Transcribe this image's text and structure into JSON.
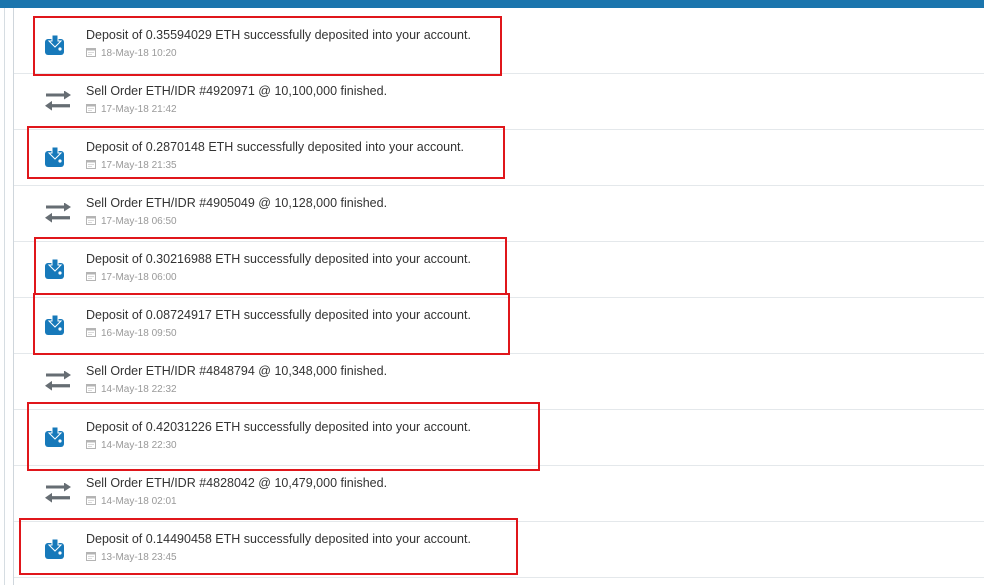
{
  "activity": {
    "items": [
      {
        "type": "deposit",
        "message": "Deposit of 0.35594029 ETH successfully deposited into your account.",
        "time": "18-May-18 10:20",
        "highlighted": true
      },
      {
        "type": "sell",
        "message": "Sell Order ETH/IDR #4920971 @ 10,100,000 finished.",
        "time": "17-May-18 21:42",
        "highlighted": false
      },
      {
        "type": "deposit",
        "message": "Deposit of 0.2870148 ETH successfully deposited into your account.",
        "time": "17-May-18 21:35",
        "highlighted": true
      },
      {
        "type": "sell",
        "message": "Sell Order ETH/IDR #4905049 @ 10,128,000 finished.",
        "time": "17-May-18 06:50",
        "highlighted": false
      },
      {
        "type": "deposit",
        "message": "Deposit of 0.30216988 ETH successfully deposited into your account.",
        "time": "17-May-18 06:00",
        "highlighted": true
      },
      {
        "type": "deposit",
        "message": "Deposit of 0.08724917 ETH successfully deposited into your account.",
        "time": "16-May-18 09:50",
        "highlighted": true
      },
      {
        "type": "sell",
        "message": "Sell Order ETH/IDR #4848794 @ 10,348,000 finished.",
        "time": "14-May-18 22:32",
        "highlighted": false
      },
      {
        "type": "deposit",
        "message": "Deposit of 0.42031226 ETH successfully deposited into your account.",
        "time": "14-May-18 22:30",
        "highlighted": true
      },
      {
        "type": "sell",
        "message": "Sell Order ETH/IDR #4828042 @ 10,479,000 finished.",
        "time": "14-May-18 02:01",
        "highlighted": false
      },
      {
        "type": "deposit",
        "message": "Deposit of 0.14490458 ETH successfully deposited into your account.",
        "time": "13-May-18 23:45",
        "highlighted": true
      }
    ]
  },
  "icons": {
    "deposit": "wallet-download-icon",
    "sell": "exchange-arrows-icon",
    "time": "calendar-icon"
  },
  "colors": {
    "header_bar": "#1b75ad",
    "deposit_icon": "#1779ba",
    "sell_icon": "#666d73",
    "highlight_border": "#e0161b"
  }
}
